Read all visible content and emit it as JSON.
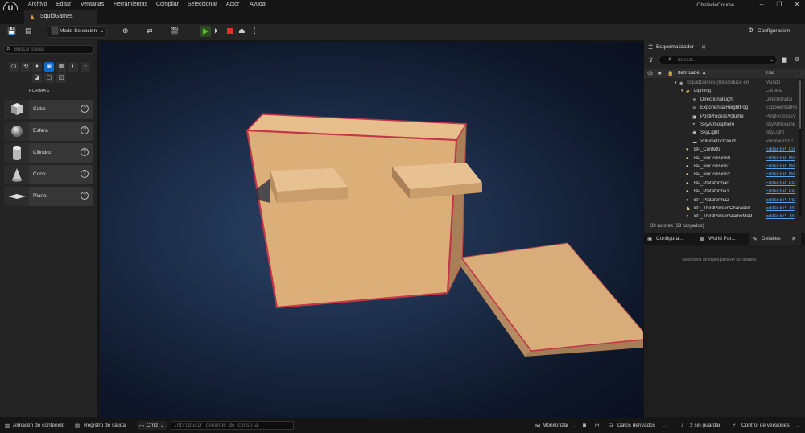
{
  "menu": {
    "items": [
      "Archivo",
      "Editar",
      "Ventanas",
      "Herramientas",
      "Compilar",
      "Seleccionar",
      "Actor",
      "Ayuda"
    ],
    "project_name": "ObstacleCourse"
  },
  "level_tab": {
    "label": "SquidGames"
  },
  "toolbar": {
    "mode_label": "Modo Selección",
    "settings_label": "Configuración"
  },
  "place_actors": {
    "search_placeholder": "Buscar clases",
    "category_label": "FORMAS",
    "shapes": [
      {
        "label": "Cubo",
        "icon": "cube-icon"
      },
      {
        "label": "Esfera",
        "icon": "sphere-icon"
      },
      {
        "label": "Cilindro",
        "icon": "cylinder-icon"
      },
      {
        "label": "Cono",
        "icon": "cone-icon"
      },
      {
        "label": "Plano",
        "icon": "plane-icon"
      }
    ]
  },
  "outliner": {
    "tab_label": "Esquematizador",
    "search_placeholder": "Buscar...",
    "col_label": "Item Label ▲",
    "col_type": "Tipo",
    "rows": [
      {
        "name": "SquidGames (Reproduce en",
        "type": "Mundo",
        "indent": 0,
        "icon": "world-icon",
        "link": false
      },
      {
        "name": "Lighting",
        "type": "Carpeta",
        "indent": 1,
        "icon": "folder-icon",
        "link": false
      },
      {
        "name": "DirectionalLight",
        "type": "DirectionalLi",
        "indent": 2,
        "icon": "light-icon",
        "link": false
      },
      {
        "name": "ExponentialHeightFog",
        "type": "ExponentialHe",
        "indent": 2,
        "icon": "fog-icon",
        "link": false
      },
      {
        "name": "PostProcessVolume",
        "type": "PostProcessV",
        "indent": 2,
        "icon": "volume-icon",
        "link": false
      },
      {
        "name": "SkyAtmosphere",
        "type": "SkyAtmosphe",
        "indent": 2,
        "icon": "sky-icon",
        "link": false
      },
      {
        "name": "SkyLight",
        "type": "SkyLight",
        "indent": 2,
        "icon": "skylight-icon",
        "link": false
      },
      {
        "name": "VolumetricCloud",
        "type": "VolumetricCl",
        "indent": 2,
        "icon": "cloud-icon",
        "link": false
      },
      {
        "name": "BP_Confetti",
        "type": "Editar BP_Co",
        "indent": 1,
        "icon": "actor-icon",
        "link": true
      },
      {
        "name": "BP_NoCollision0",
        "type": "Editar BP_No",
        "indent": 1,
        "icon": "actor-icon",
        "link": true
      },
      {
        "name": "BP_NoCollision1",
        "type": "Editar BP_No",
        "indent": 1,
        "icon": "actor-icon",
        "link": true
      },
      {
        "name": "BP_NoCollision2",
        "type": "Editar BP_No",
        "indent": 1,
        "icon": "actor-icon",
        "link": true
      },
      {
        "name": "BP_Plataforma0",
        "type": "Editar BP_Pla",
        "indent": 1,
        "icon": "actor-icon",
        "link": true
      },
      {
        "name": "BP_Plataforma1",
        "type": "Editar BP_Pla",
        "indent": 1,
        "icon": "actor-icon",
        "link": true
      },
      {
        "name": "BP_Plataforma2",
        "type": "Editar BP_Pla",
        "indent": 1,
        "icon": "actor-icon",
        "link": true
      },
      {
        "name": "BP_ThirdPersonCharacter",
        "type": "Editar BP_Th",
        "indent": 1,
        "icon": "character-icon",
        "link": true
      },
      {
        "name": "BP_ThirdPersonGameMod",
        "type": "Editar BP_Th",
        "indent": 1,
        "icon": "actor-icon",
        "link": true
      }
    ],
    "actor_count": "33 actores (33 cargados)"
  },
  "details": {
    "tabs": [
      "Configura...",
      "World Par...",
      "Detalles"
    ],
    "empty_message": "Selecciona un objeto para ver los detalles"
  },
  "statusbar": {
    "content_drawer": "Almacén de contenido",
    "output_log": "Registro de salida",
    "cmd_label": "Cmd",
    "console_placeholder": "Introducir comando de consola",
    "monitor": "Monitorizar",
    "derived_data": "Datos derivados",
    "unsaved": "2 sin guardar",
    "source_control": "Control de versiones"
  },
  "colors": {
    "accent": "#0e6cc4",
    "play_green": "#56c12e",
    "stop_red": "#e0302a",
    "link_blue": "#5aa2e8",
    "box_face": "#dcae78",
    "box_edge": "#c2364a"
  }
}
